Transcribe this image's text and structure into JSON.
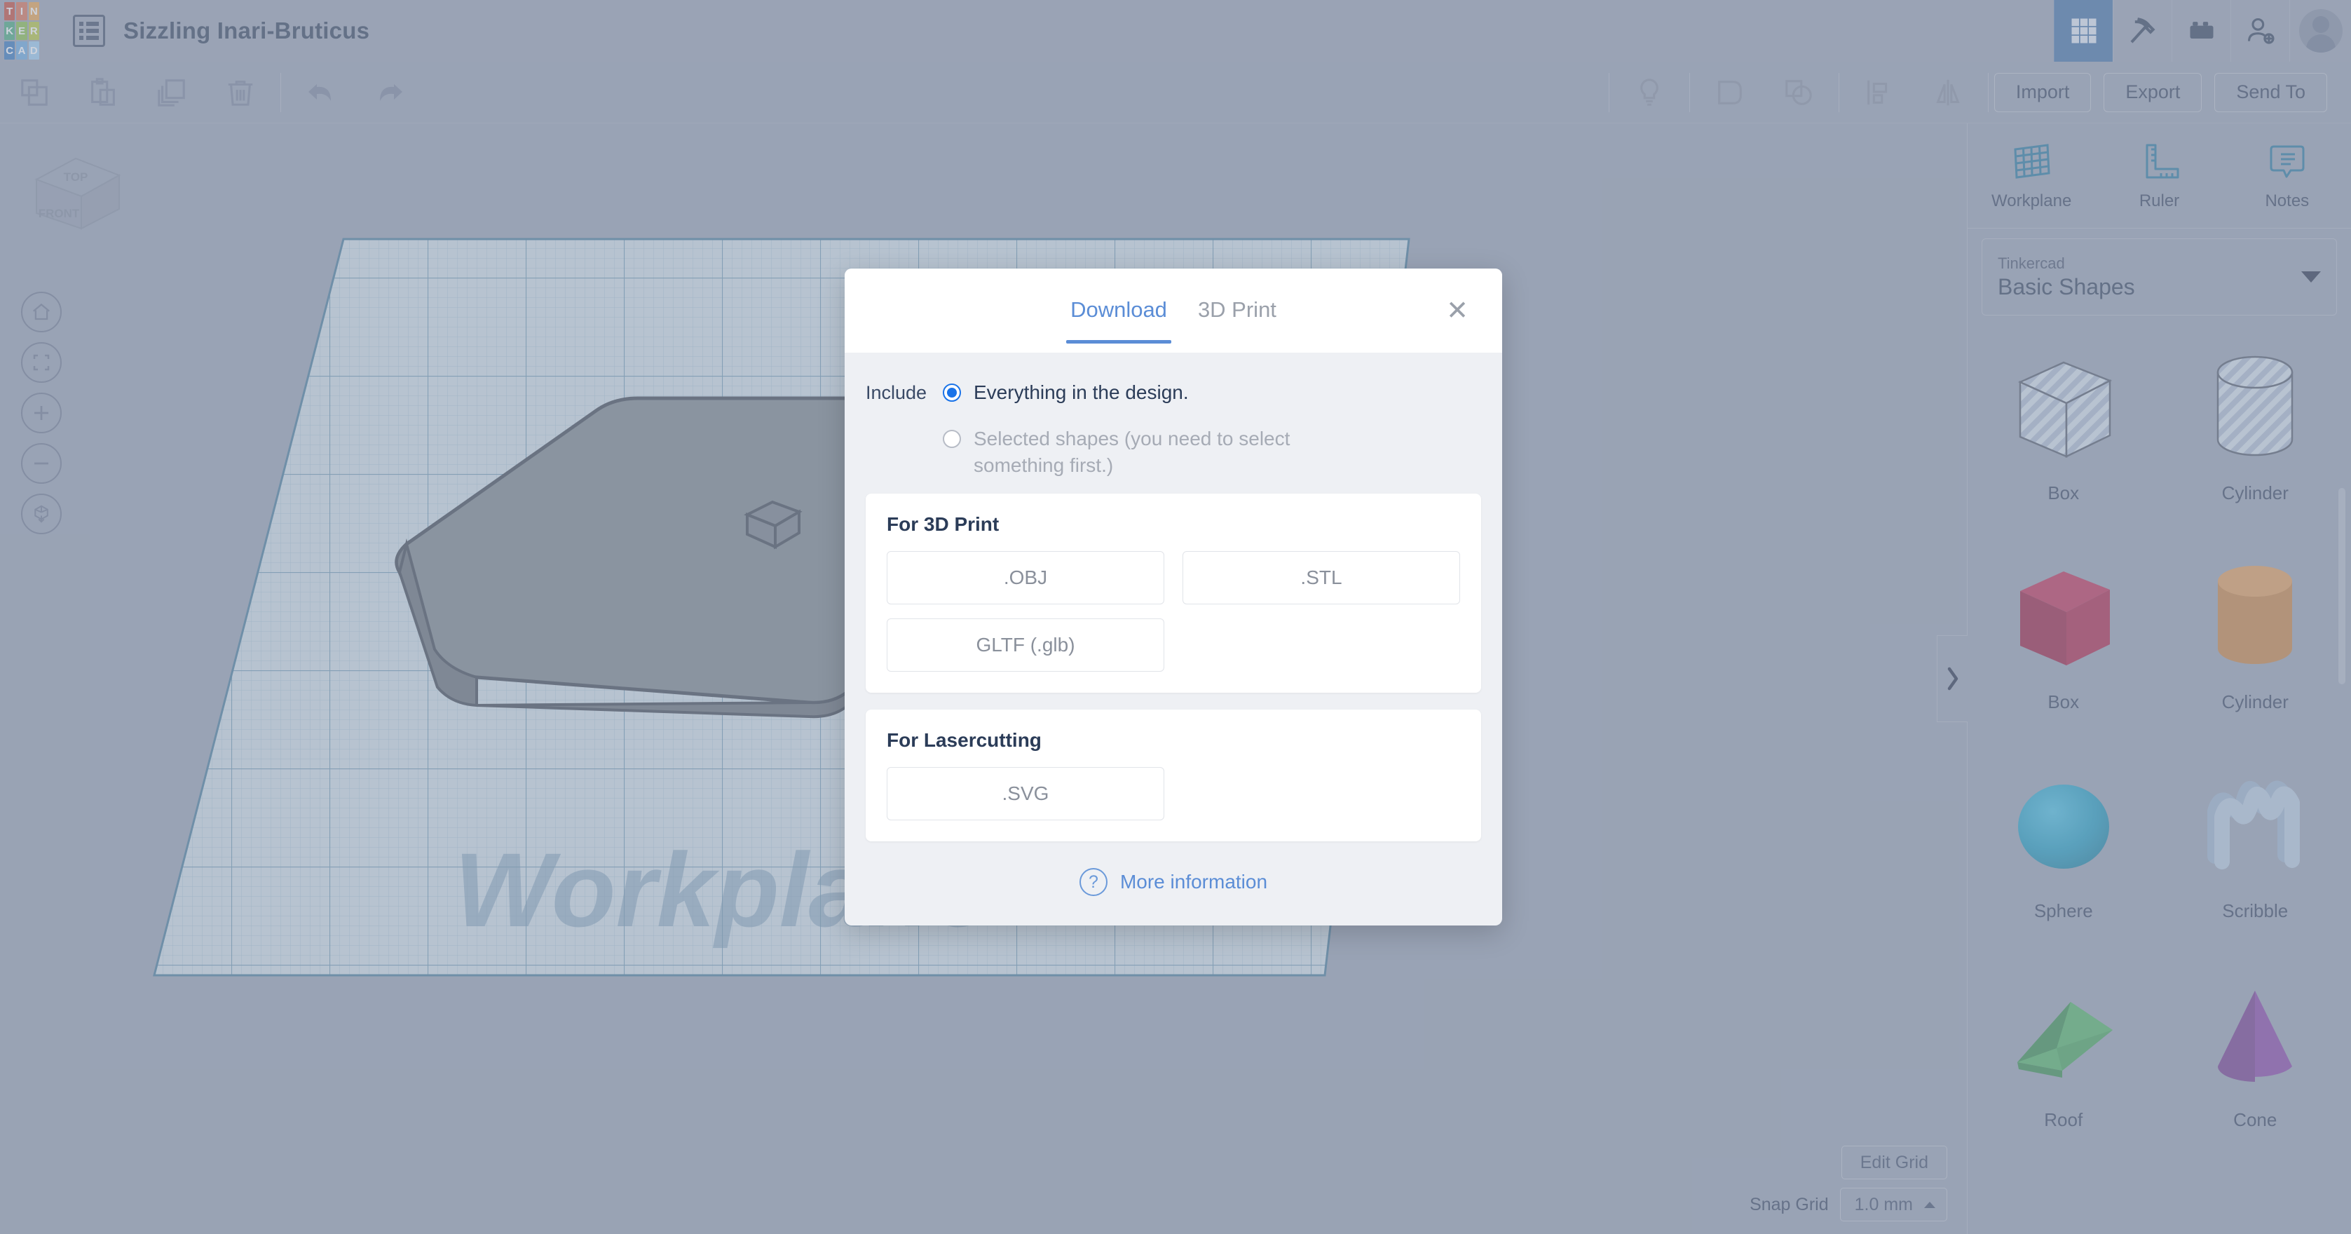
{
  "app": {
    "logo_letters": [
      "T",
      "I",
      "N",
      "K",
      "E",
      "R",
      "C",
      "A",
      "D"
    ],
    "logo_colors": [
      "#b5463a",
      "#c96a53",
      "#d89a4e",
      "#3f9e78",
      "#7cb34a",
      "#a8bb3f",
      "#2f6fb5",
      "#5f9ed6",
      "#8fc0e5"
    ],
    "document_title": "Sizzling Inari-Bruticus",
    "design_panel_icon": "list-panel-icon"
  },
  "topbar_buttons": [
    {
      "name": "grid-view-button",
      "icon": "grid-icon",
      "active": true
    },
    {
      "name": "minecraft-button",
      "icon": "pickaxe-icon",
      "active": false
    },
    {
      "name": "blocks-button",
      "icon": "lego-brick-icon",
      "active": false
    },
    {
      "name": "invite-button",
      "icon": "user-plus-icon",
      "active": false
    }
  ],
  "toolbar": {
    "left_tools": [
      {
        "name": "copy-button",
        "icon": "copy-icon"
      },
      {
        "name": "paste-button",
        "icon": "clipboard-icon"
      },
      {
        "name": "duplicate-button",
        "icon": "duplicate-icon"
      },
      {
        "name": "delete-button",
        "icon": "trash-icon"
      },
      {
        "name": "undo-button",
        "icon": "undo-arrow-icon"
      },
      {
        "name": "redo-button",
        "icon": "redo-arrow-icon"
      }
    ],
    "right_tools": [
      {
        "name": "light-button",
        "icon": "lightbulb-icon"
      },
      {
        "name": "group-button",
        "icon": "group-shapes-icon"
      },
      {
        "name": "ungroup-button",
        "icon": "ungroup-shapes-icon"
      },
      {
        "name": "align-button",
        "icon": "align-icon"
      },
      {
        "name": "mirror-button",
        "icon": "mirror-icon"
      }
    ],
    "import_label": "Import",
    "export_label": "Export",
    "sendto_label": "Send To"
  },
  "canvas": {
    "viewcube_top": "TOP",
    "viewcube_front": "FRONT",
    "workplane_watermark": "Workplane",
    "nav_buttons": [
      {
        "name": "home-view-button",
        "icon": "home-icon"
      },
      {
        "name": "fit-to-view-button",
        "icon": "fit-frame-icon"
      },
      {
        "name": "zoom-in-button",
        "icon": "plus-icon"
      },
      {
        "name": "zoom-out-button",
        "icon": "minus-icon"
      },
      {
        "name": "ortho-perspective-button",
        "icon": "cube-arrow-icon"
      }
    ],
    "edit_grid_label": "Edit Grid",
    "snap_grid_label": "Snap Grid",
    "snap_grid_value": "1.0 mm"
  },
  "right_panel": {
    "tools": [
      {
        "label": "Workplane",
        "icon": "workplane-grid-icon"
      },
      {
        "label": "Ruler",
        "icon": "ruler-icon"
      },
      {
        "label": "Notes",
        "icon": "note-callout-icon"
      }
    ],
    "library_source": "Tinkercad",
    "library_name": "Basic Shapes",
    "collapse_icon": "chevron-right-icon",
    "shapes": [
      {
        "label": "Box",
        "art": "box-hole",
        "color": "#b8c3d2"
      },
      {
        "label": "Cylinder",
        "art": "cylinder-hole",
        "color": "#b8c3d2"
      },
      {
        "label": "Box",
        "art": "box-solid",
        "color": "#9e1f46"
      },
      {
        "label": "Cylinder",
        "art": "cylinder-solid",
        "color": "#c08447"
      },
      {
        "label": "Sphere",
        "art": "sphere-solid",
        "color": "#1892b8"
      },
      {
        "label": "Scribble",
        "art": "scribble-solid",
        "color": "#8fa8c4"
      },
      {
        "label": "Roof",
        "art": "roof-solid",
        "color": "#3a9455"
      },
      {
        "label": "Cone",
        "art": "cone-solid",
        "color": "#7b3f9e"
      }
    ]
  },
  "modal": {
    "tabs": [
      {
        "label": "Download",
        "active": true
      },
      {
        "label": "3D Print",
        "active": false
      }
    ],
    "close_label": "✕",
    "include_label": "Include",
    "options": [
      {
        "label": "Everything in the design.",
        "selected": true,
        "disabled": false
      },
      {
        "label": "Selected shapes (you need to select something first.)",
        "selected": false,
        "disabled": true
      }
    ],
    "sections": [
      {
        "title": "For 3D Print",
        "formats": [
          {
            "label": ".OBJ",
            "half": true
          },
          {
            "label": ".STL",
            "half": true
          },
          {
            "label": "GLTF (.glb)",
            "half": true
          }
        ]
      },
      {
        "title": "For Lasercutting",
        "formats": [
          {
            "label": ".SVG",
            "half": true
          }
        ]
      }
    ],
    "footer_link": "More information",
    "footer_icon": "question-circle-icon",
    "accent_color": "#5b8dd6"
  }
}
